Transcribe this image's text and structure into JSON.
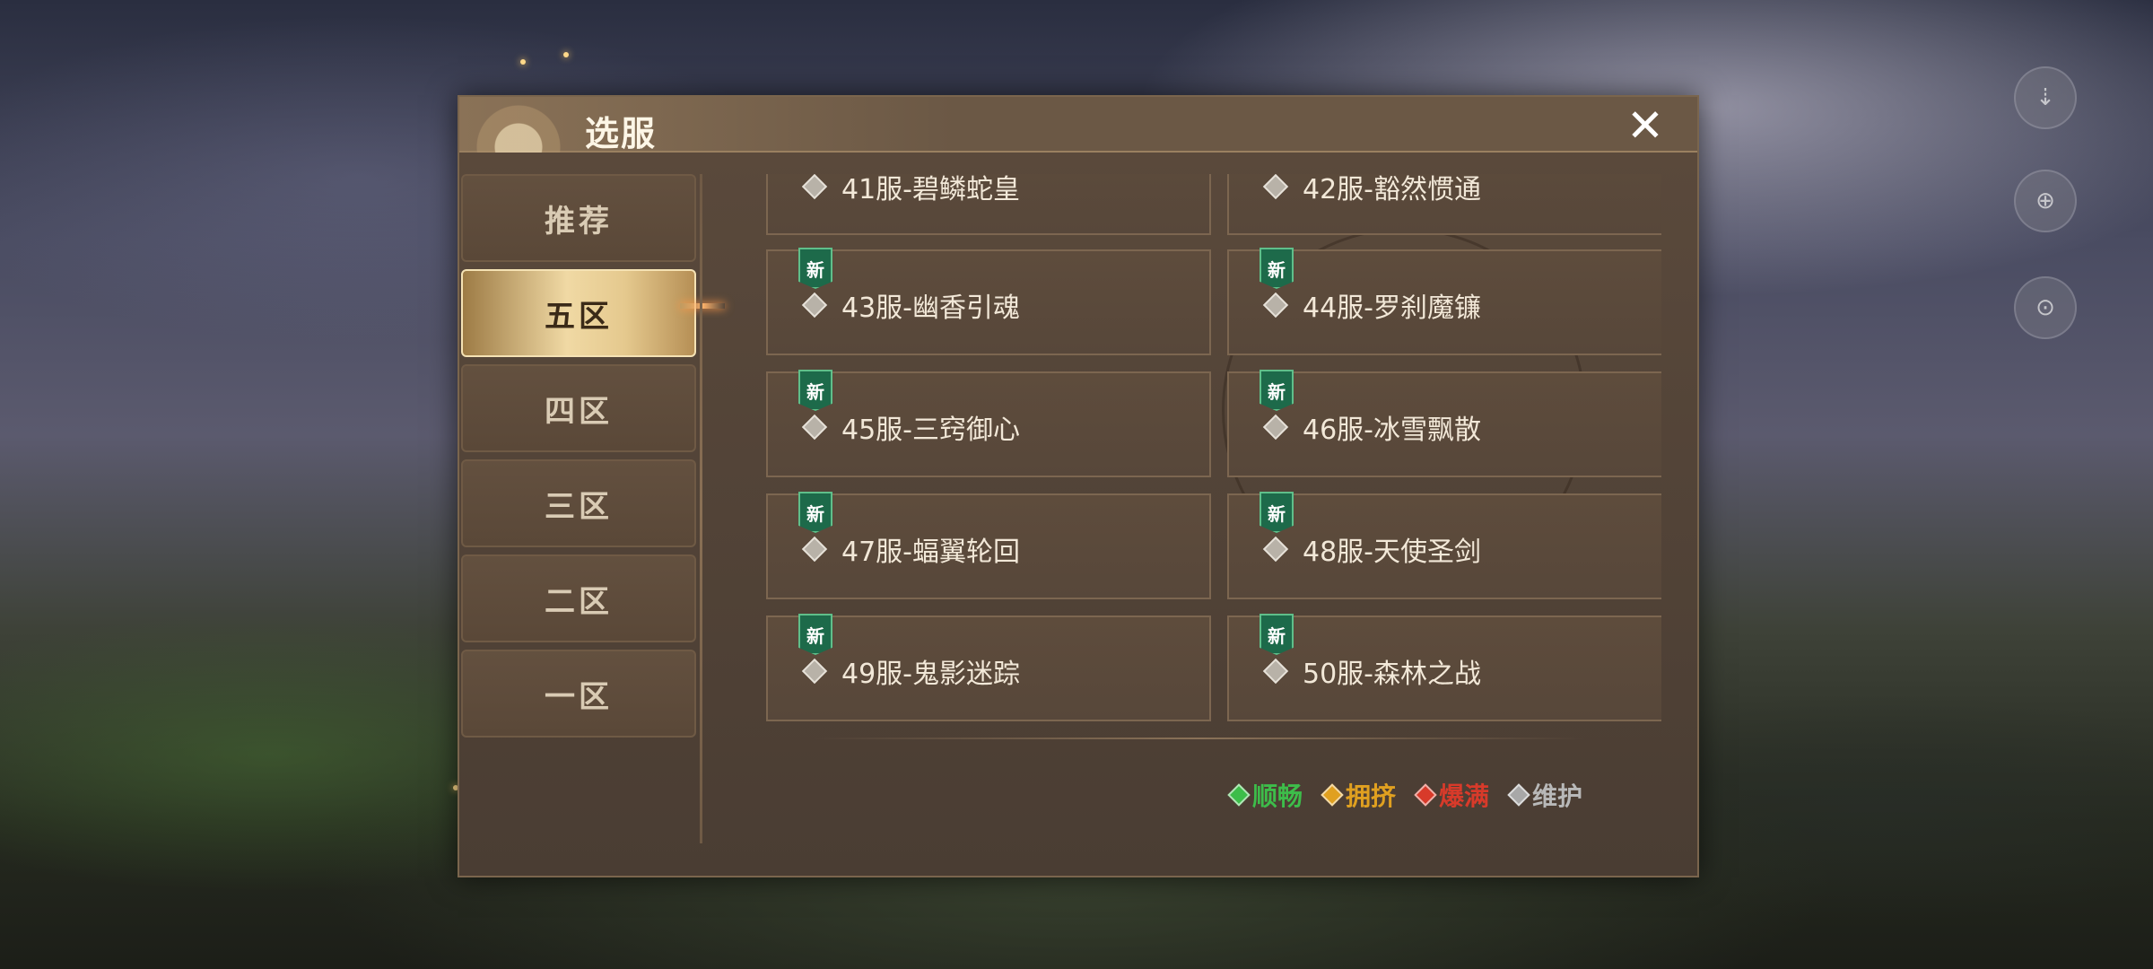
{
  "dialog": {
    "title": "选服",
    "close_icon": "close-icon"
  },
  "tabs": [
    {
      "label": "推荐",
      "active": false
    },
    {
      "label": "五区",
      "active": true
    },
    {
      "label": "四区",
      "active": false
    },
    {
      "label": "三区",
      "active": false
    },
    {
      "label": "二区",
      "active": false
    },
    {
      "label": "一区",
      "active": false
    }
  ],
  "servers": [
    {
      "label": "41服-碧鳞蛇皇",
      "badge": ""
    },
    {
      "label": "42服-豁然惯通",
      "badge": ""
    },
    {
      "label": "43服-幽香引魂",
      "badge": "新"
    },
    {
      "label": "44服-罗刹魔镰",
      "badge": "新"
    },
    {
      "label": "45服-三窍御心",
      "badge": "新"
    },
    {
      "label": "46服-冰雪飘散",
      "badge": "新"
    },
    {
      "label": "47服-蝠翼轮回",
      "badge": "新"
    },
    {
      "label": "48服-天使圣剑",
      "badge": "新"
    },
    {
      "label": "49服-鬼影迷踪",
      "badge": "新"
    },
    {
      "label": "50服-森林之战",
      "badge": "新"
    }
  ],
  "legend": [
    {
      "label": "顺畅",
      "color": "#3dbd4a"
    },
    {
      "label": "拥挤",
      "color": "#e0a020"
    },
    {
      "label": "爆满",
      "color": "#d83a2a"
    },
    {
      "label": "维护",
      "color": "#a8a8a8"
    }
  ],
  "colors": {
    "dialog_bg": "#4a3d33",
    "active_tab": "#f0d9a4",
    "new_badge": "#1d6a4a"
  }
}
